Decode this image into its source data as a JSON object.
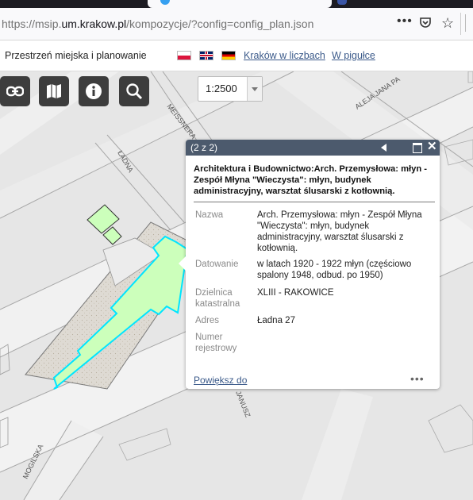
{
  "browser": {
    "url_prefix": "https://msip.",
    "url_domain": "um.krakow.pl",
    "url_suffix": "/kompozycje/?config=config_plan.json",
    "page_actions_icon": "•••",
    "pocket_icon": "pocket-icon",
    "bookmark_icon": "☆"
  },
  "header": {
    "title": "Przestrzeń miejska i planowanie",
    "flags": [
      "pl-flag",
      "uk-flag",
      "de-flag"
    ],
    "links": [
      "Kraków w liczbach",
      "W pigułce"
    ]
  },
  "toolbar": {
    "buttons": [
      "link-icon",
      "map-icon",
      "info-icon",
      "search-icon"
    ],
    "scale": "1:2500"
  },
  "map": {
    "streets": [
      "MEISSNERA",
      "ŁADNA",
      "ALEJA JANA PA",
      "JANUSZ",
      "MOGILSKA"
    ],
    "highlight_color": "#00e5ff",
    "fill_color": "#ccffbb"
  },
  "popup": {
    "counter": "(2 z 2)",
    "title": "Architektura i Budownictwo:Arch. Przemysłowa: młyn - Zespół Młyna \"Wieczysta\": młyn, budynek administracyjny, warsztat ślusarski z kotłownią.",
    "fields": [
      {
        "label": "Nazwa",
        "value": "Arch. Przemysłowa: młyn - Zespół Młyna \"Wieczysta\": młyn, budynek administracyjny, warsztat ślusarski z kotłownią."
      },
      {
        "label": "Datowanie",
        "value": "w latach 1920 - 1922 młyn (częściowo spalony 1948, odbud. po 1950)"
      },
      {
        "label": "Dzielnica katastralna",
        "value": "XLIII - RAKOWICE"
      },
      {
        "label": "Adres",
        "value": "Ładna 27"
      },
      {
        "label": "Numer rejestrowy",
        "value": ""
      }
    ],
    "zoom_link": "Powiększ do",
    "more_icon": "•••"
  }
}
